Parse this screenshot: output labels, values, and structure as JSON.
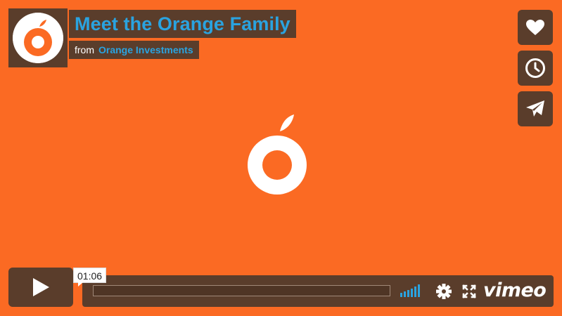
{
  "video": {
    "title": "Meet the Orange Family",
    "byline_prefix": "from",
    "author": "Orange Investments"
  },
  "side_actions": [
    {
      "name": "like",
      "icon": "heart-icon"
    },
    {
      "name": "watch-later",
      "icon": "clock-icon"
    },
    {
      "name": "share",
      "icon": "paper-plane-icon"
    }
  ],
  "controls": {
    "play_icon": "play-icon",
    "current_time": "01:06",
    "progress": 0.0,
    "volume_icon": "volume-bars-icon",
    "settings_icon": "gear-icon",
    "fullscreen_icon": "fullscreen-icon",
    "brand": "vimeo"
  },
  "colors": {
    "background": "#fb6a23",
    "panel": "#5a3d2b",
    "accent": "#2aa3e0",
    "text": "#ffffff"
  }
}
